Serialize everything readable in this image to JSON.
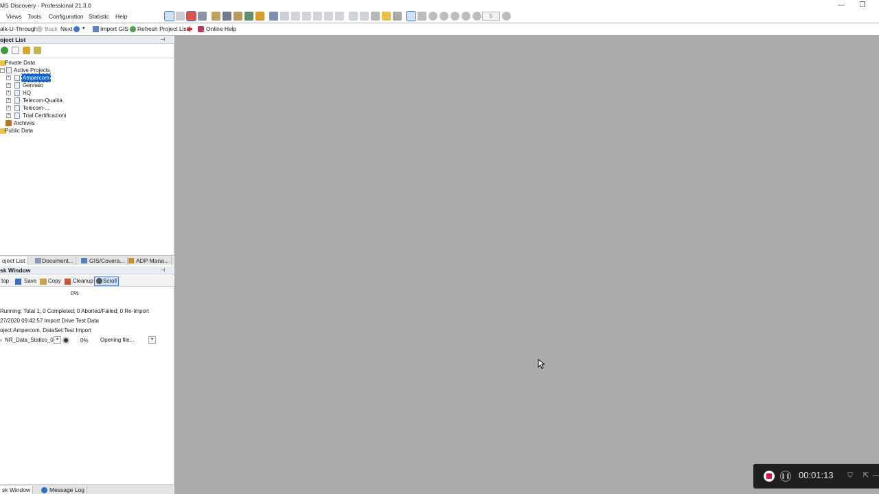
{
  "window": {
    "title": "MS Discovery - Professional 21.3.0",
    "minimize_glyph": "—",
    "restore_glyph": "❐"
  },
  "menu": {
    "items": [
      "Views",
      "Tools",
      "Configuration",
      "Statistic",
      "Help"
    ]
  },
  "toolbar_top": {
    "page_box_value": "5"
  },
  "toolbar_secondary": {
    "walk_through": "alk-U-Through",
    "back": "Back",
    "next": "Next",
    "import_gis": "Import GIS",
    "refresh": "Refresh Project List",
    "online_help": "Online Help"
  },
  "project_list": {
    "header": "oject List",
    "pin": "📌",
    "tree": [
      {
        "label": "Private Data",
        "level": 0
      },
      {
        "label": "Active Projects",
        "level": 1
      },
      {
        "label": "Ampercom",
        "level": 2,
        "selected": true
      },
      {
        "label": "Gennaio",
        "level": 2
      },
      {
        "label": "HQ",
        "level": 2
      },
      {
        "label": "Telecom-Qualità",
        "level": 2
      },
      {
        "label": "Telecom-...",
        "level": 2
      },
      {
        "label": "Trial Certificazioni",
        "level": 2
      },
      {
        "label": "Archives",
        "level": 1
      },
      {
        "label": "Public Data",
        "level": 0
      }
    ]
  },
  "tabs_top": [
    "oject List",
    "Document...",
    "GIS/Covera...",
    "ADP Mana..."
  ],
  "task_window": {
    "header": "sk Window",
    "pin": "📌",
    "buttons": {
      "stop": "top",
      "save": "Save",
      "copy": "Copy",
      "cleanup": "Cleanup",
      "scroll": "Scroll"
    },
    "overall_progress": "0%",
    "summary": "Running; Total 1; 0 Completed; 0 Aborted/Failed; 0 Re-Import",
    "log_line": "27/2020 09:42:57 Import Drive Test Data",
    "project_line": "oject:Ampercom, DataSet:Test Import",
    "task": {
      "file": "NR_Data_Statico_01",
      "progress": "0%",
      "status": "Opening file..."
    }
  },
  "tabs_bottom": [
    "sk Window",
    "Message Log"
  ],
  "recorder": {
    "elapsed": "00:01:13"
  },
  "colors": {
    "selection": "#0a64d6",
    "record": "#d3125a",
    "workspace": "#ababab"
  }
}
